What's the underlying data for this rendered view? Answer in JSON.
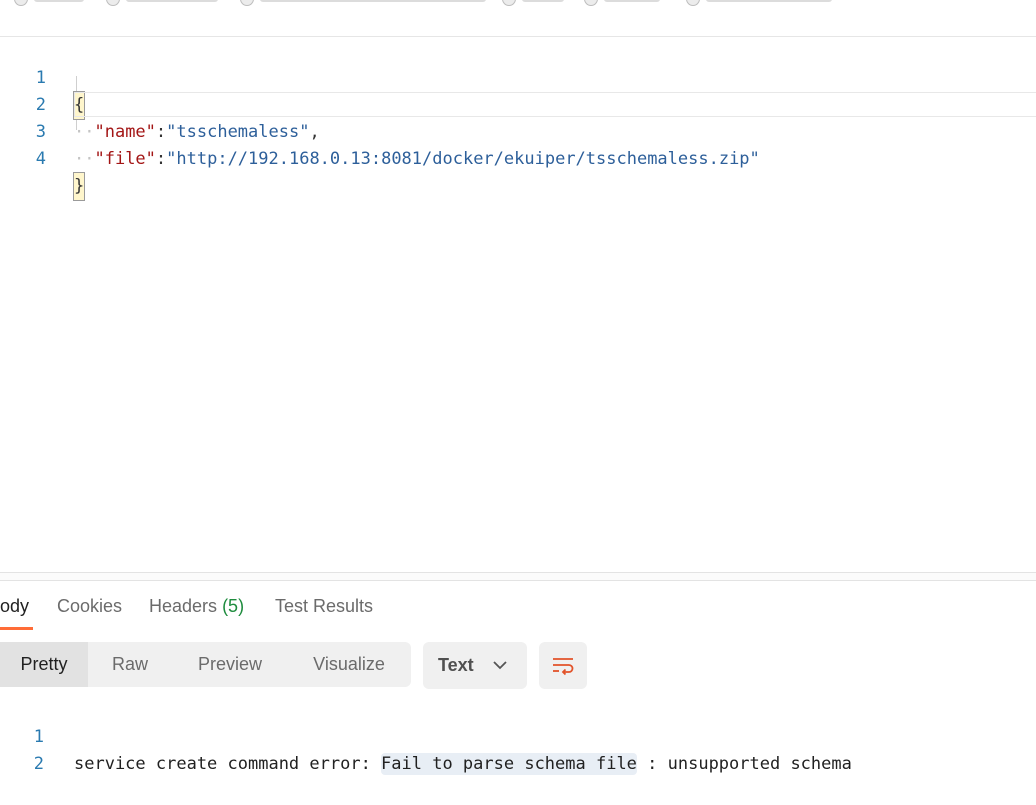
{
  "editor": {
    "lines": [
      {
        "num": "1",
        "open": "{"
      },
      {
        "num": "2",
        "key": "\"name\"",
        "colon": ":",
        "value": "\"tsschemaless\"",
        "comma": ","
      },
      {
        "num": "3",
        "key": "\"file\"",
        "colon": ":",
        "value": "\"http://192.168.0.13:8081/docker/ekuiper/tsschemaless.zip\""
      },
      {
        "num": "4",
        "close": "}"
      }
    ]
  },
  "response": {
    "tabs": [
      {
        "label": "ody",
        "active": true
      },
      {
        "label": "Cookies"
      },
      {
        "label": "Headers",
        "count": "(5)"
      },
      {
        "label": "Test Results"
      }
    ],
    "views": [
      "Pretty",
      "Raw",
      "Preview",
      "Visualize"
    ],
    "active_view": "Pretty",
    "format": "Text",
    "lines": [
      {
        "num": "1",
        "prefix": "service create command error: ",
        "highlight": "Fail to parse schema file",
        "suffix": " : unsupported schema"
      },
      {
        "num": "2",
        "text": ""
      }
    ]
  },
  "colors": {
    "accent": "#ff6c37",
    "count": "#1e8c3e",
    "line_numbers": "#2a7ab0"
  }
}
